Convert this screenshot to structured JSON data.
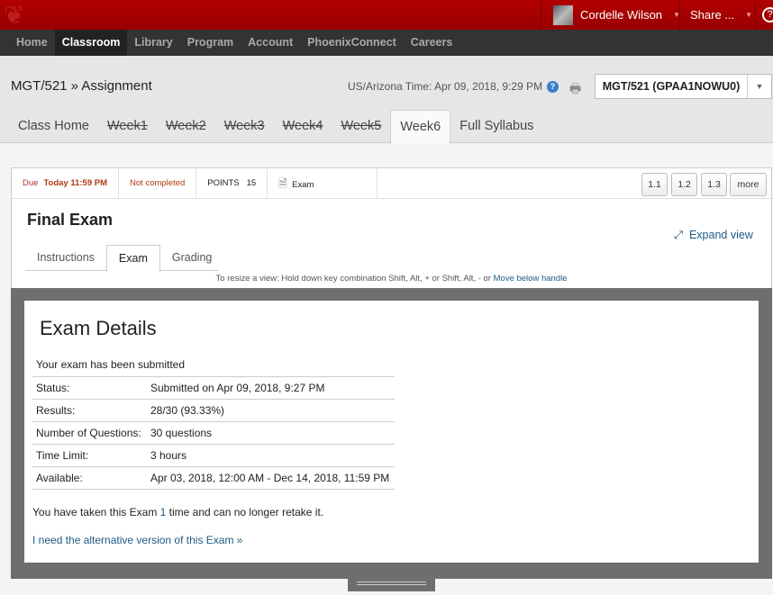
{
  "topbar": {
    "user_name": "Cordelle Wilson",
    "share_label": "Share ..."
  },
  "nav": [
    "Home",
    "Classroom",
    "Library",
    "Program",
    "Account",
    "PhoenixConnect",
    "Careers"
  ],
  "header": {
    "breadcrumb": "MGT/521 » Assignment",
    "time": "US/Arizona Time: Apr 09, 2018, 9:29 PM",
    "course_select": "MGT/521 (GPAA1NOWU0)"
  },
  "weeks": [
    "Class Home",
    "Week1",
    "Week2",
    "Week3",
    "Week4",
    "Week5",
    "Week6",
    "Full Syllabus"
  ],
  "meta": {
    "due_label": "Due",
    "due_value": "Today 11:59 PM",
    "status": "Not completed",
    "points_label": "POINTS",
    "points_value": "15",
    "type": "Exam"
  },
  "quick_buttons": [
    "1.1",
    "1.2",
    "1.3",
    "more"
  ],
  "assignment": {
    "title": "Final Exam",
    "expand": "Expand view",
    "tabs": [
      "Instructions",
      "Exam",
      "Grading"
    ],
    "hint": "To resize a view: Hold down key combination Shift, Alt, + or Shift, Alt, - or ",
    "hint_link": "Move below handle"
  },
  "exam": {
    "heading": "Exam Details",
    "submitted": "Your exam has been submitted",
    "rows": [
      {
        "label": "Status:",
        "value": "Submitted on Apr 09, 2018, 9:27 PM"
      },
      {
        "label": "Results:",
        "value": "28/30 (93.33%)"
      },
      {
        "label": "Number of Questions:",
        "value": "30 questions"
      },
      {
        "label": "Time Limit:",
        "value": "3 hours"
      },
      {
        "label": "Available:",
        "value": "Apr 03, 2018, 12:00 AM - Dec 14, 2018, 11:59 PM"
      }
    ],
    "taken_pre": "You have taken this Exam ",
    "taken_count": "1",
    "taken_post": " time and can no longer retake it.",
    "alt_link": "I need the alternative version of this Exam »"
  }
}
